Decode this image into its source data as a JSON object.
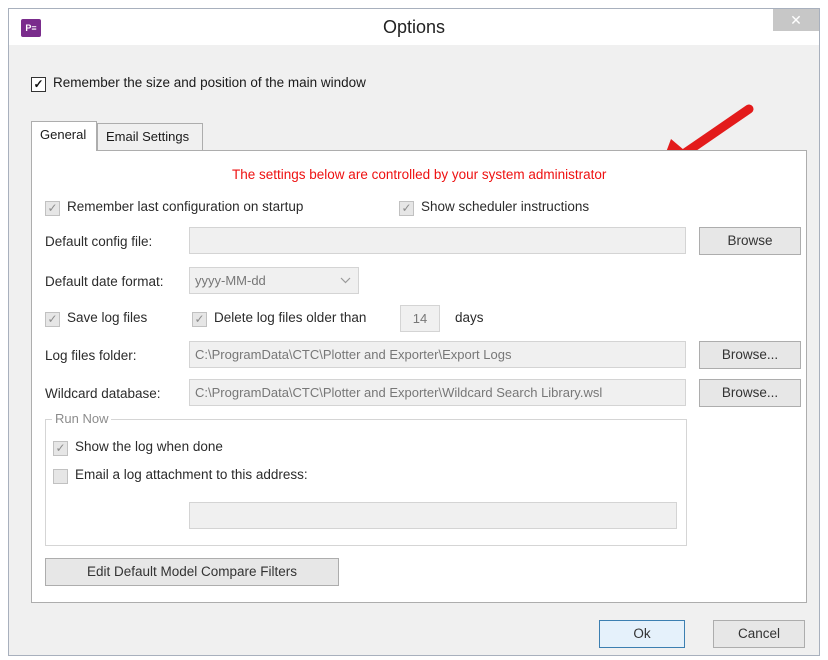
{
  "window": {
    "title": "Options",
    "close_glyph": "✕",
    "app_icon": "plotter-exporter-icon",
    "app_icon_text": "P≡"
  },
  "remember_window": {
    "label": "Remember the size and position of the main window",
    "checked": true
  },
  "tabs": [
    {
      "label": "General",
      "active": true
    },
    {
      "label": "Email Settings",
      "active": false
    }
  ],
  "general": {
    "admin_notice": "The settings below are controlled by your system administrator",
    "admin_notice_color": "#ee1111",
    "arrow_color": "#e31b1b",
    "remember_last_config": {
      "label": "Remember last configuration on startup",
      "checked": true
    },
    "show_scheduler": {
      "label": "Show scheduler instructions",
      "checked": true
    },
    "default_config": {
      "label": "Default config file:",
      "value": "",
      "browse_label": "Browse"
    },
    "date_format": {
      "label": "Default date format:",
      "value": "yyyy-MM-dd"
    },
    "save_logs": {
      "label": "Save log files",
      "checked": true
    },
    "delete_logs": {
      "label": "Delete log files older than",
      "checked": true,
      "days_value": "14",
      "days_unit": "days"
    },
    "log_folder": {
      "label": "Log files folder:",
      "value": "C:\\ProgramData\\CTC\\Plotter and Exporter\\Export Logs",
      "browse_label": "Browse..."
    },
    "wildcard_db": {
      "label": "Wildcard database:",
      "value": "C:\\ProgramData\\CTC\\Plotter and Exporter\\Wildcard Search Library.wsl",
      "browse_label": "Browse..."
    },
    "run_now": {
      "title": "Run Now",
      "show_log": {
        "label": "Show the log when done",
        "checked": true
      },
      "email_log": {
        "label": "Email a log attachment to this address:",
        "checked": false
      },
      "email_address": ""
    },
    "edit_filters_label": "Edit Default Model Compare Filters"
  },
  "footer": {
    "ok_label": "Ok",
    "cancel_label": "Cancel"
  }
}
